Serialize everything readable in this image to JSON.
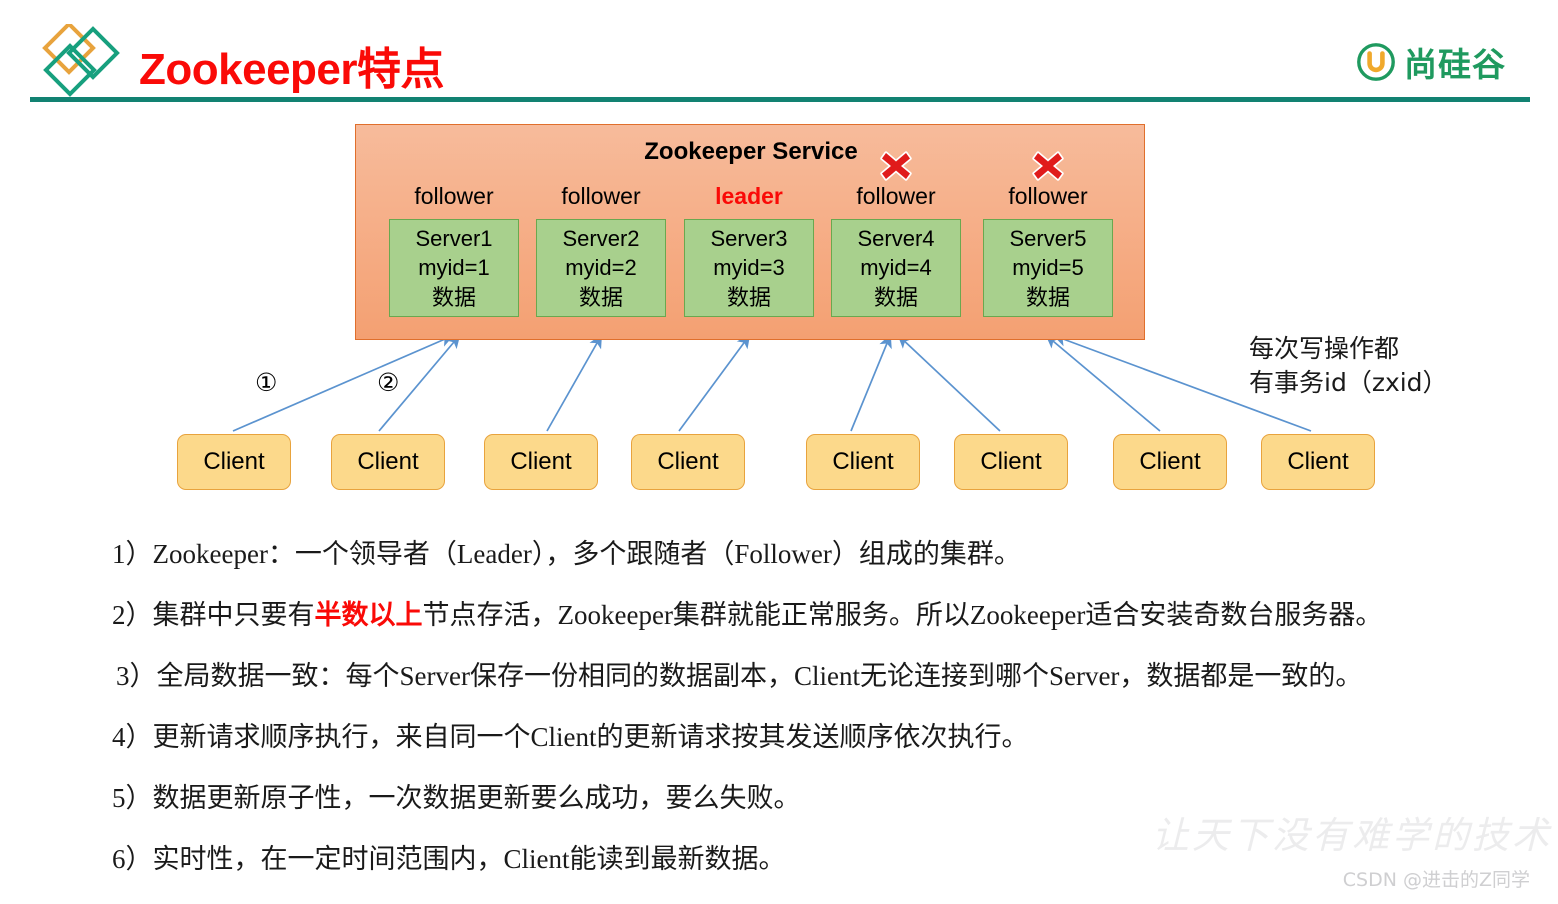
{
  "header": {
    "title": "Zookeeper特点",
    "title_color": "#fa0a07",
    "rule_color": "#128272",
    "logo_icon": "diamonds-logo-icon",
    "brand": {
      "icon": "atguigu-u-icon",
      "text": "尚硅谷",
      "color": "#1f9a5f"
    }
  },
  "diagram": {
    "service_title": "Zookeeper Service",
    "service_fill": "#f4a072",
    "server_fill": "#a8d08d",
    "client_fill": "#fcd98b",
    "arrow_color": "#4a87c8",
    "nodes": [
      {
        "role": "follower",
        "name": "Server1",
        "myid": "myid=1",
        "data": "数据",
        "is_leader": false,
        "dead": false
      },
      {
        "role": "follower",
        "name": "Server2",
        "myid": "myid=2",
        "data": "数据",
        "is_leader": false,
        "dead": false
      },
      {
        "role": "leader",
        "name": "Server3",
        "myid": "myid=3",
        "data": "数据",
        "is_leader": true,
        "dead": false
      },
      {
        "role": "follower",
        "name": "Server4",
        "myid": "myid=4",
        "data": "数据",
        "is_leader": false,
        "dead": true
      },
      {
        "role": "follower",
        "name": "Server5",
        "myid": "myid=5",
        "data": "数据",
        "is_leader": false,
        "dead": true
      }
    ],
    "step_labels": [
      "①",
      "②"
    ],
    "note": {
      "line1": "每次写操作都",
      "line2": "有事务id（zxid）"
    },
    "clients": [
      {
        "label": "Client"
      },
      {
        "label": "Client"
      },
      {
        "label": "Client"
      },
      {
        "label": "Client"
      },
      {
        "label": "Client"
      },
      {
        "label": "Client"
      },
      {
        "label": "Client"
      },
      {
        "label": "Client"
      }
    ]
  },
  "points": [
    {
      "index": "1）",
      "before": "Zookeeper：一个领导者（Leader），多个跟随者（Follower）组成的集群。",
      "highlight": "",
      "after": ""
    },
    {
      "index": "2）",
      "before": "集群中只要有",
      "highlight": "半数以上",
      "after": "节点存活，Zookeeper集群就能正常服务。所以Zookeeper适合安装奇数台服务器。"
    },
    {
      "index": "3）",
      "before": "全局数据一致：每个Server保存一份相同的数据副本，Client无论连接到哪个Server，数据都是一致的。",
      "highlight": "",
      "after": ""
    },
    {
      "index": "4）",
      "before": "更新请求顺序执行，来自同一个Client的更新请求按其发送顺序依次执行。",
      "highlight": "",
      "after": ""
    },
    {
      "index": "5）",
      "before": "数据更新原子性，一次数据更新要么成功，要么失败。",
      "highlight": "",
      "after": ""
    },
    {
      "index": "6）",
      "before": "实时性，在一定时间范围内，Client能读到最新数据。",
      "highlight": "",
      "after": ""
    }
  ],
  "watermark": "让天下没有难学的技术",
  "csdn_credit": "CSDN @进击的Z同学"
}
